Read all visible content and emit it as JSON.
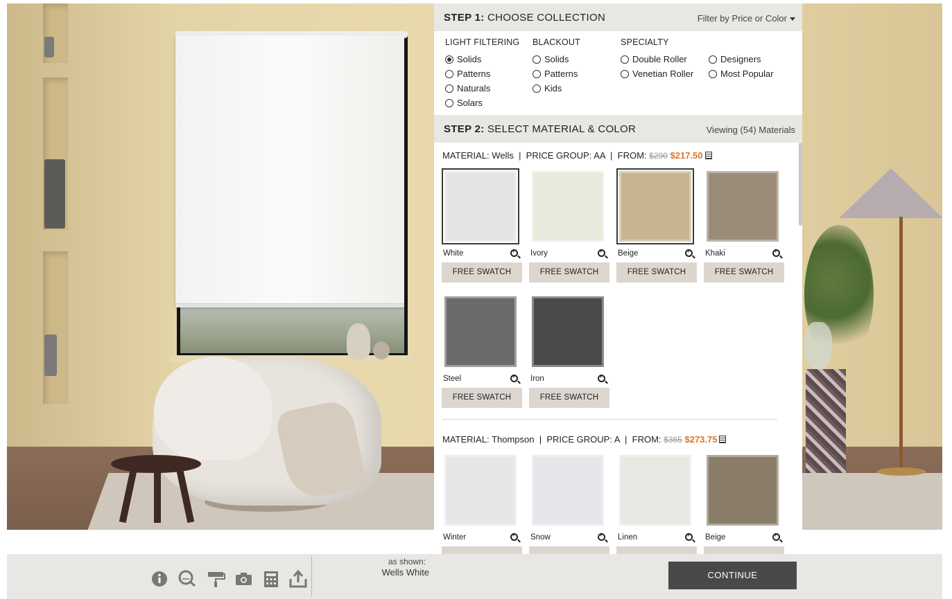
{
  "step1": {
    "label_bold": "STEP 1:",
    "label": "CHOOSE COLLECTION",
    "filter_label": "Filter by Price or Color"
  },
  "collections": {
    "light_filtering": {
      "heading": "LIGHT FILTERING",
      "options": [
        "Solids",
        "Patterns",
        "Naturals",
        "Solars"
      ],
      "selected": "Solids"
    },
    "blackout": {
      "heading": "BLACKOUT",
      "options": [
        "Solids",
        "Patterns",
        "Kids"
      ]
    },
    "specialty": {
      "heading": "SPECIALTY",
      "options_col1": [
        "Double Roller",
        "Venetian Roller"
      ],
      "options_col2": [
        "Designers",
        "Most Popular"
      ]
    }
  },
  "step2": {
    "label_bold": "STEP 2:",
    "label": "SELECT MATERIAL & COLOR",
    "viewing": "Viewing (54) Materials"
  },
  "materials": [
    {
      "material_label": "MATERIAL:",
      "name": "Wells",
      "price_group_label": "PRICE GROUP:",
      "price_group": "AA",
      "from_label": "FROM:",
      "old_price": "$290",
      "price": "$217.50",
      "swatch_button": "FREE SWATCH",
      "colors": [
        {
          "name": "White",
          "hex": "#e4e4e4",
          "selected": true
        },
        {
          "name": "Ivory",
          "hex": "#e9eadb",
          "selected": false
        },
        {
          "name": "Beige",
          "hex": "#c8b48f",
          "selected": true
        },
        {
          "name": "Khaki",
          "hex": "#9b8c7a",
          "selected": false
        },
        {
          "name": "Steel",
          "hex": "#6b6b6b",
          "selected": false
        },
        {
          "name": "Iron",
          "hex": "#4a4a4b",
          "selected": false
        }
      ]
    },
    {
      "material_label": "MATERIAL:",
      "name": "Thompson",
      "price_group_label": "PRICE GROUP:",
      "price_group": "A",
      "from_label": "FROM:",
      "old_price": "$365",
      "price": "$273.75",
      "colors": [
        {
          "name": "Winter",
          "hex": "#e6e6e7"
        },
        {
          "name": "Snow",
          "hex": "#e5e6e9"
        },
        {
          "name": "Linen",
          "hex": "#e8e7e2"
        },
        {
          "name": "Beige",
          "hex": "#8a7d69"
        }
      ]
    }
  ],
  "toolbar": {
    "icons": [
      "info-icon",
      "measure-icon",
      "paint-roller-icon",
      "camera-icon",
      "calculator-icon",
      "share-upload-icon"
    ],
    "as_shown_label": "as shown:",
    "as_shown_value": "Wells  White",
    "continue_label": "CONTINUE"
  },
  "colors": {
    "price_accent": "#e07326",
    "header_bg": "#e9e7e3",
    "button_bg": "#ddd6cf",
    "continue_bg": "#4a4848"
  }
}
